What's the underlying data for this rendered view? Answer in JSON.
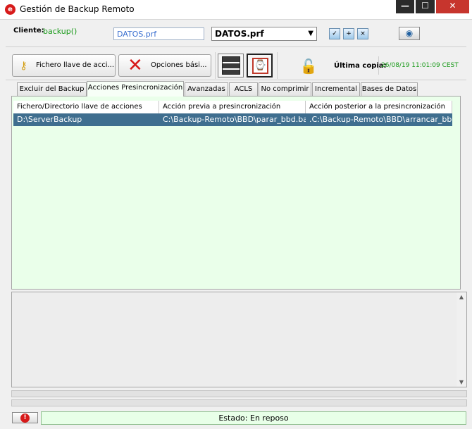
{
  "window": {
    "title": "Gestión de Backup Remoto",
    "minimize_label": "—",
    "maximize_label": "☐",
    "close_label": "✕"
  },
  "client": {
    "label": "Cliente:",
    "value": "backup()",
    "profile_field": "DATOS.prf",
    "profile_select": "DATOS.prf",
    "select_arrow": "▼"
  },
  "toolbar": {
    "key_button_label": "Fichero llave de acci...",
    "options_button_label": "Opciones bási...",
    "last_copy_label": "Última copia:",
    "last_copy_value": "26/08/19 11:01:09 CEST"
  },
  "tabs": [
    {
      "label": "Excluir del Backup"
    },
    {
      "label": "Acciones Presincronización"
    },
    {
      "label": "Avanzadas"
    },
    {
      "label": "ACLS"
    },
    {
      "label": "No comprimir"
    },
    {
      "label": "Incremental"
    },
    {
      "label": "Bases de Datos"
    }
  ],
  "table": {
    "columns": [
      "Fichero/Directorio llave de acciones",
      "Acción previa a presincronización",
      "Acción posterior a la presincronización"
    ],
    "rows": [
      [
        "D:\\ServerBackup",
        "C:\\Backup-Remoto\\BBD\\parar_bbd.bat",
        ".C:\\Backup-Remoto\\BBD\\arrancar_bbd..."
      ]
    ]
  },
  "status": {
    "text": "Estado: En reposo",
    "stop_glyph": "!"
  },
  "colors": {
    "accent_green": "#1a9a1a",
    "list_background": "#eaffea",
    "selected_row": "#3f6e8f",
    "close_red": "#c7352d",
    "icon_red": "#d71a1a"
  },
  "icons": {
    "app": "app-logo-icon",
    "key": "key-icon",
    "wrench": "wrench-icon",
    "server": "server-icon",
    "clock": "clock-icon",
    "lock": "lock-icon",
    "eye": "eye-icon",
    "stop": "stop-icon"
  }
}
